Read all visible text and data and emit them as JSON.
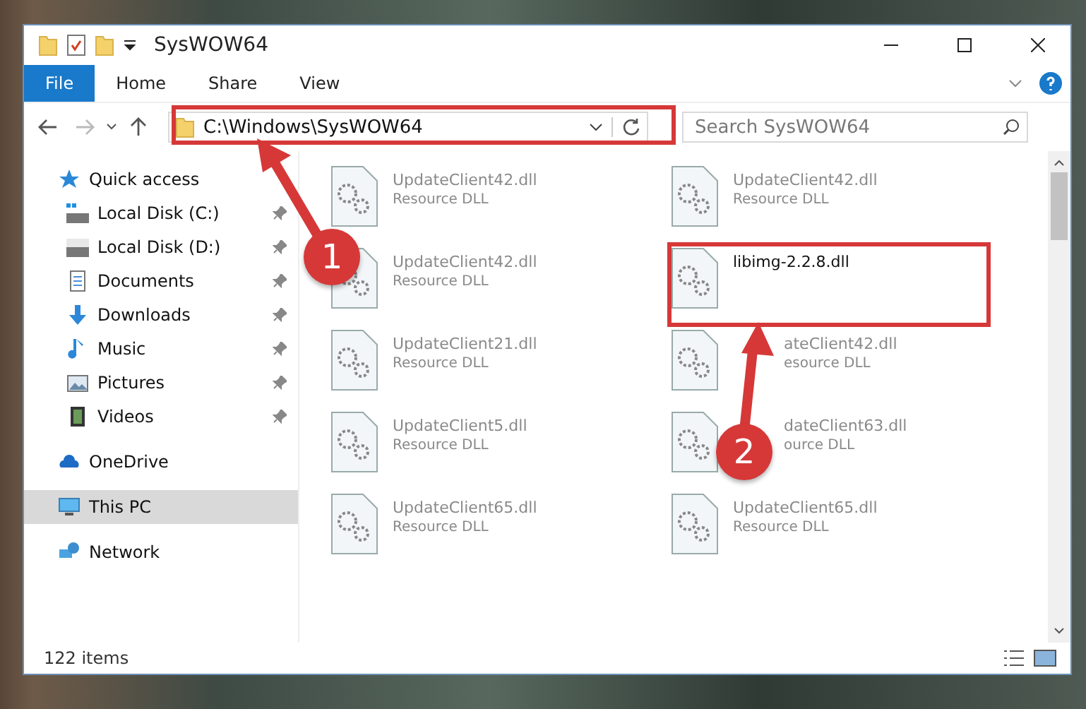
{
  "window": {
    "title": "SysWOW64"
  },
  "ribbon_tabs": [
    {
      "label": "File",
      "kind": "file",
      "selected": false
    },
    {
      "label": "Home",
      "kind": "tab",
      "selected": false
    },
    {
      "label": "Share",
      "kind": "tab",
      "selected": false
    },
    {
      "label": "View",
      "kind": "tab",
      "selected": false
    }
  ],
  "address": {
    "path": "C:\\Windows\\SysWOW64"
  },
  "search": {
    "placeholder": "Search SysWOW64"
  },
  "sidebar": {
    "items": [
      {
        "label": "Quick access",
        "selected": false,
        "children": [
          {
            "label": "Local Disk (C:)",
            "pinned": true
          },
          {
            "label": "Local Disk (D:)",
            "pinned": true
          },
          {
            "label": "Documents",
            "pinned": true
          },
          {
            "label": "Downloads",
            "pinned": true
          },
          {
            "label": "Music",
            "pinned": true
          },
          {
            "label": "Pictures",
            "pinned": true
          },
          {
            "label": "Videos",
            "pinned": true
          }
        ]
      },
      {
        "label": "OneDrive",
        "selected": false
      },
      {
        "label": "This PC",
        "selected": true
      },
      {
        "label": "Network",
        "selected": false
      }
    ]
  },
  "files": [
    {
      "name": "UpdateClient42.dll",
      "type": "Resource DLL",
      "blurred": true
    },
    {
      "name": "UpdateClient42.dll",
      "type": "Resource DLL",
      "blurred": true
    },
    {
      "name": "UpdateClient42.dll",
      "type": "Resource DLL",
      "blurred": true
    },
    {
      "name": "libimg-2.2.8.dll",
      "blurred": false
    },
    {
      "name": "UpdateClient21.dll",
      "type": "Resource DLL",
      "blurred": true
    },
    {
      "name": "ateClient42.dll",
      "type": "esource DLL",
      "blurred": true,
      "kind": "partly_covered"
    },
    {
      "name": "UpdateClient5.dll",
      "type": "Resource DLL",
      "blurred": true
    },
    {
      "name": "dateClient63.dll",
      "type": "ource DLL",
      "blurred": true,
      "kind": "partly_covered"
    },
    {
      "name": "UpdateClient65.dll",
      "type": "Resource DLL",
      "blurred": true
    },
    {
      "name": "UpdateClient65.dll",
      "type": "Resource DLL",
      "blurred": true
    }
  ],
  "status_bar": {
    "item_count": "122 items"
  },
  "annotations": [
    {
      "number": "1"
    },
    {
      "number": "2"
    }
  ]
}
